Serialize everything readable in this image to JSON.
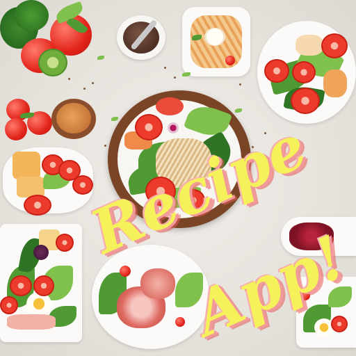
{
  "title": {
    "line1": "Recipe",
    "line2": "App!"
  },
  "colors": {
    "background": "#e9e6e1",
    "title_fill": "#f4f15a",
    "title_shadow": "#f29a9a",
    "bowl_rim": "#7a4526"
  },
  "scene": "overhead-food-spread"
}
